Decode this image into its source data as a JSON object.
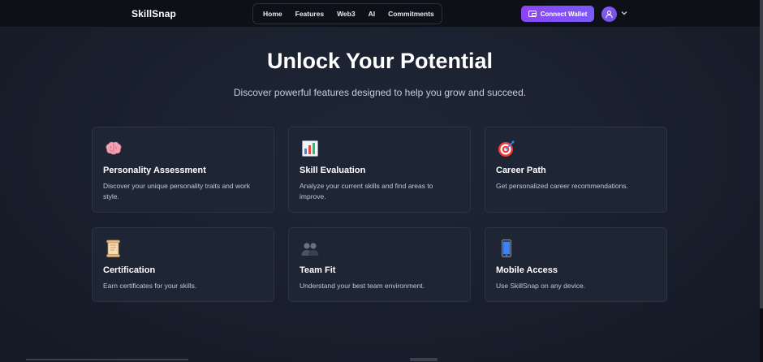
{
  "header": {
    "logo": "SkillSnap",
    "nav": [
      "Home",
      "Features",
      "Web3",
      "AI",
      "Commitments"
    ],
    "wallet_label": "Connect Wallet"
  },
  "hero": {
    "title": "Unlock Your Potential",
    "subtitle": "Discover powerful features designed to help you grow and succeed."
  },
  "features": [
    {
      "icon": "brain-icon",
      "title": "Personality Assessment",
      "description": "Discover your unique personality traits and work style."
    },
    {
      "icon": "bar-chart-icon",
      "title": "Skill Evaluation",
      "description": "Analyze your current skills and find areas to improve."
    },
    {
      "icon": "target-icon",
      "title": "Career Path",
      "description": "Get personalized career recommendations."
    },
    {
      "icon": "scroll-icon",
      "title": "Certification",
      "description": "Earn certificates for your skills."
    },
    {
      "icon": "people-icon",
      "title": "Team Fit",
      "description": "Understand your best team environment."
    },
    {
      "icon": "mobile-phone-icon",
      "title": "Mobile Access",
      "description": "Use SkillSnap on any device."
    }
  ],
  "colors": {
    "accent": "#8b45f5",
    "background": "#1a2130",
    "card": "#1e2535",
    "header": "#0d1016"
  }
}
